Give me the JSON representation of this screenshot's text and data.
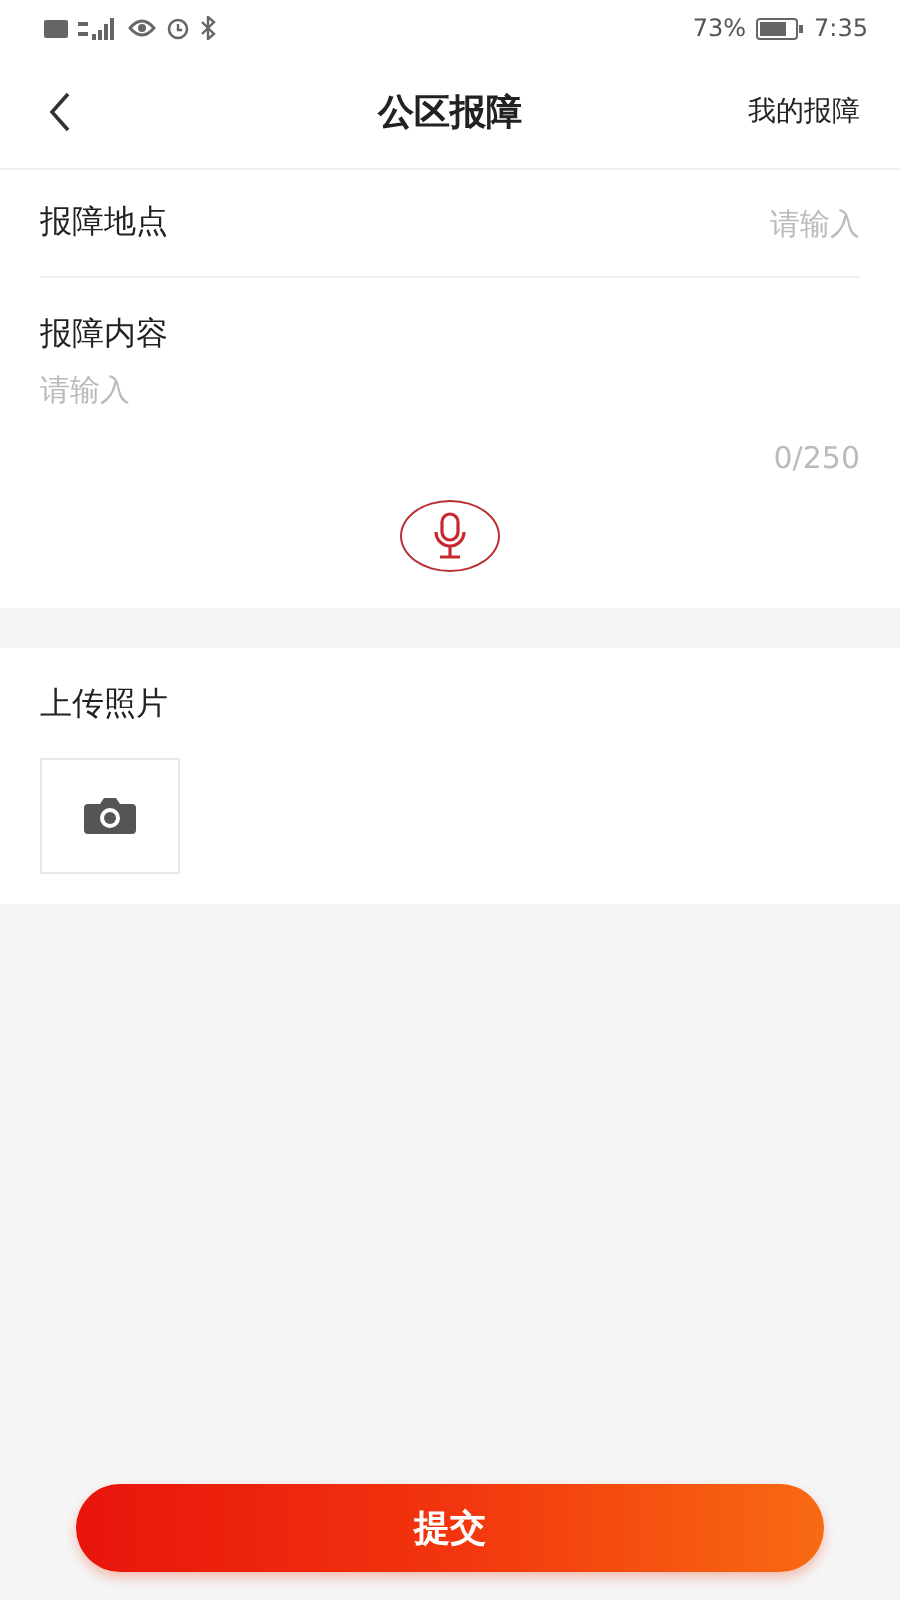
{
  "status_bar": {
    "battery_text": "73%",
    "time": "7:35"
  },
  "header": {
    "title": "公区报障",
    "action": "我的报障"
  },
  "form": {
    "location": {
      "label": "报障地点",
      "placeholder": "请输入"
    },
    "content": {
      "label": "报障内容",
      "placeholder": "请输入",
      "counter": "0/250"
    }
  },
  "upload": {
    "label": "上传照片"
  },
  "submit": {
    "label": "提交"
  }
}
